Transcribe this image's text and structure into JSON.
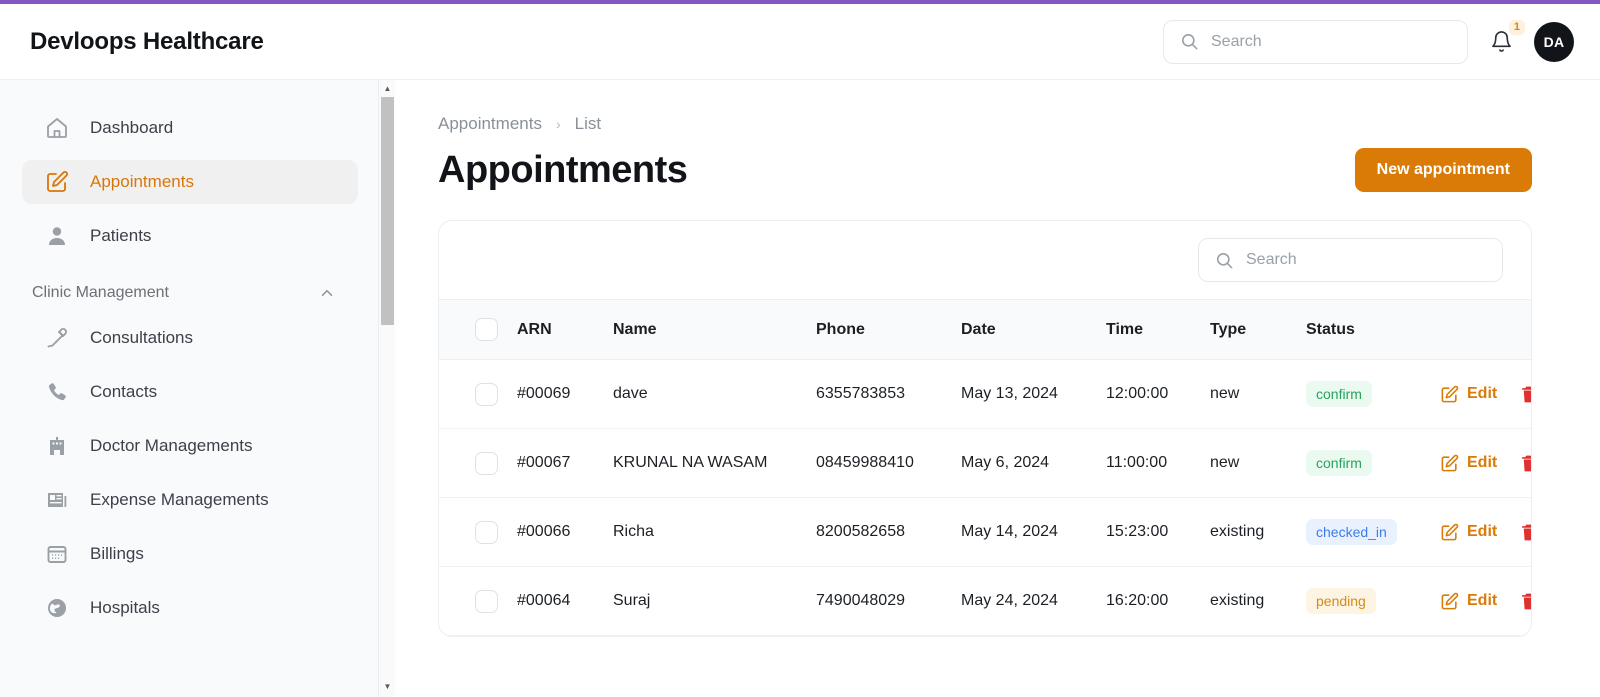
{
  "loading_bar": {
    "color": "#8257c2",
    "progress_label": ""
  },
  "header": {
    "brand": "Devloops Healthcare",
    "search": {
      "placeholder": "Search",
      "value": "",
      "icon": "search-icon"
    },
    "notifications": {
      "icon": "bell-icon",
      "count": "1"
    },
    "avatar": {
      "initials": "DA"
    }
  },
  "sidebar": {
    "items": [
      {
        "label": "Dashboard",
        "icon": "home-icon",
        "active": false
      },
      {
        "label": "Appointments",
        "icon": "edit-square-icon",
        "active": true
      },
      {
        "label": "Patients",
        "icon": "user-icon",
        "active": false
      }
    ],
    "section": {
      "label": "Clinic Management",
      "chevron": "chevron-up-icon"
    },
    "section_items": [
      {
        "label": "Consultations",
        "icon": "pipette-icon"
      },
      {
        "label": "Contacts",
        "icon": "phone-icon"
      },
      {
        "label": "Doctor Managements",
        "icon": "building-icon"
      },
      {
        "label": "Expense Managements",
        "icon": "news-icon"
      },
      {
        "label": "Billings",
        "icon": "calendar-icon"
      },
      {
        "label": "Hospitals",
        "icon": "globe-icon"
      }
    ]
  },
  "main": {
    "breadcrumb": {
      "parent": "Appointments",
      "separator": "›",
      "current": "List"
    },
    "title": "Appointments",
    "new_button": "New appointment",
    "table_search": {
      "placeholder": "Search",
      "value": "",
      "icon": "search-icon"
    },
    "columns": [
      "ARN",
      "Name",
      "Phone",
      "Date",
      "Time",
      "Type",
      "Status"
    ],
    "rows": [
      {
        "arn": "#00069",
        "name": "dave",
        "phone": "6355783853",
        "date": "May 13, 2024",
        "time": "12:00:00",
        "type": "new",
        "status": "confirm",
        "status_kind": "confirm",
        "edit_label": "Edit",
        "delete_icon": "trash-icon"
      },
      {
        "arn": "#00067",
        "name": "KRUNAL NA WASAM",
        "phone": "08459988410",
        "date": "May 6, 2024",
        "time": "11:00:00",
        "type": "new",
        "status": "confirm",
        "status_kind": "confirm",
        "edit_label": "Edit",
        "delete_icon": "trash-icon"
      },
      {
        "arn": "#00066",
        "name": "Richa",
        "phone": "8200582658",
        "date": "May 14, 2024",
        "time": "15:23:00",
        "type": "existing",
        "status": "checked_in",
        "status_kind": "checked_in",
        "edit_label": "Edit",
        "delete_icon": "trash-icon"
      },
      {
        "arn": "#00064",
        "name": "Suraj",
        "phone": "7490048029",
        "date": "May 24, 2024",
        "time": "16:20:00",
        "type": "existing",
        "status": "pending",
        "status_kind": "pending",
        "edit_label": "Edit",
        "delete_icon": "trash-icon"
      }
    ]
  },
  "colors": {
    "accent_orange": "#d97b06",
    "loading_purple": "#8257c2",
    "status_confirm": "#27a35c",
    "status_checked_in": "#3b7ded",
    "status_pending": "#d18b1e",
    "delete_red": "#e03131"
  }
}
